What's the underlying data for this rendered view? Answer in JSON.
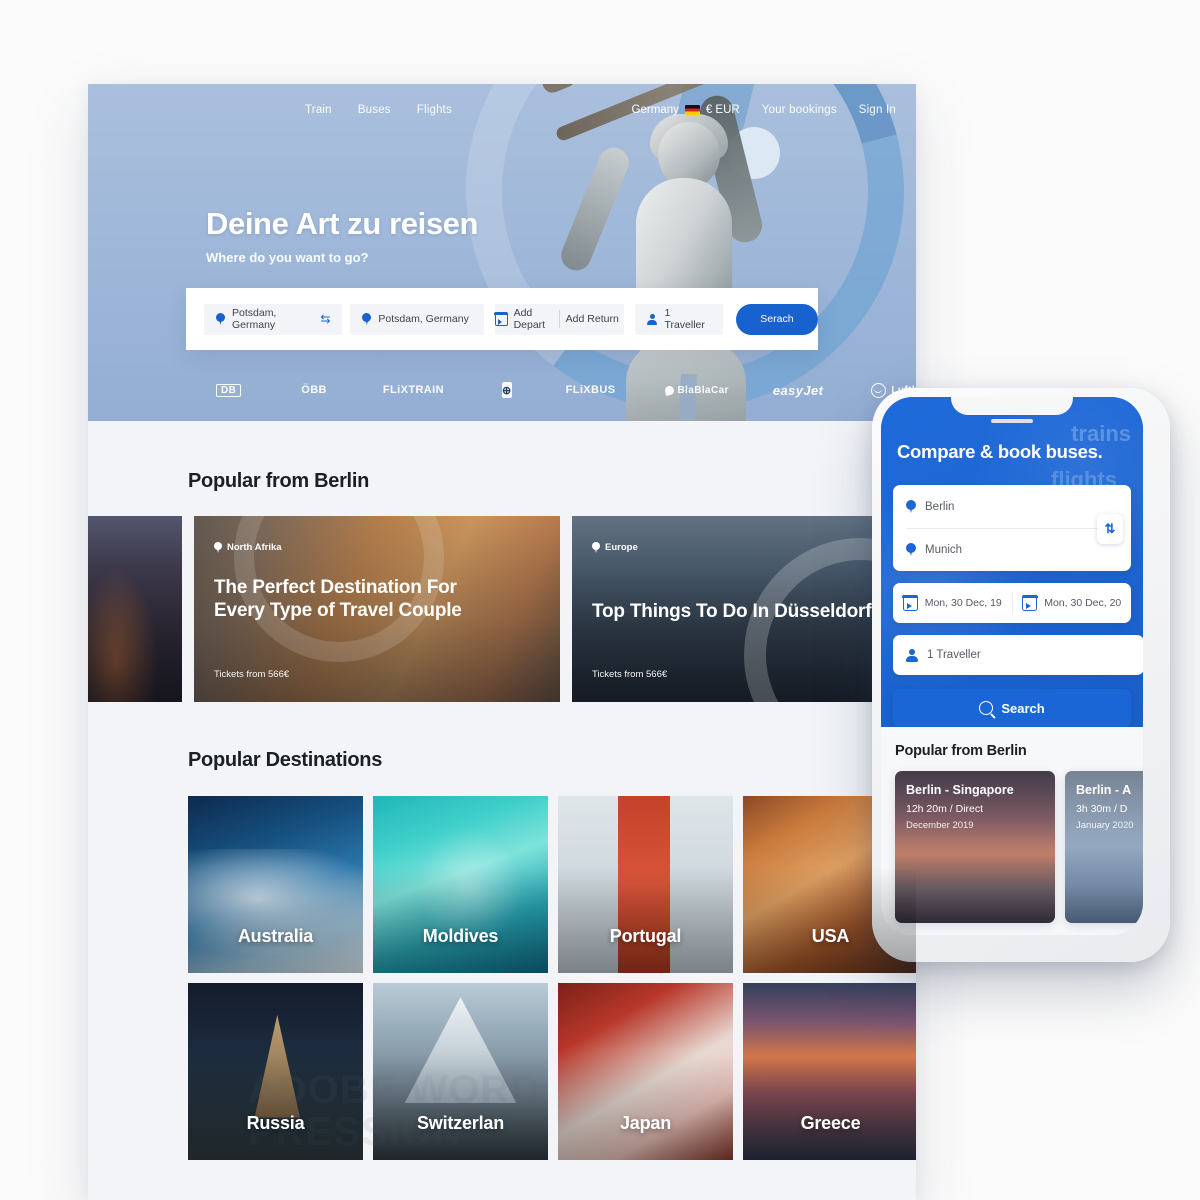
{
  "desktop": {
    "nav": {
      "left_links": [
        "Train",
        "Buses",
        "Flights"
      ],
      "country": "Germany",
      "currency": "€ EUR",
      "bookings": "Your bookings",
      "signin": "Sign In"
    },
    "hero": {
      "title": "Deine Art zu reisen",
      "subtitle": "Where do you want to go?"
    },
    "search": {
      "origin": "Potsdam, Germany",
      "destination": "Potsdam, Germany",
      "depart": "Add Depart",
      "return": "Add Return",
      "travellers": "1 Traveller",
      "button": "Serach",
      "swap_icon": "⇆"
    },
    "partners": [
      "DB",
      "ÖBB",
      "FLiXTRAIN",
      "SBB",
      "FLiXBUS",
      "BlaBlaCar",
      "easyJet",
      "Lufthansa"
    ],
    "popular_from": {
      "title": "Popular from Berlin",
      "cards": [
        {
          "tag": "",
          "heading": "",
          "price": ""
        },
        {
          "tag": "North Afrika",
          "heading": "The Perfect Destination For Every Type of Travel Couple",
          "price": "Tickets from 566€"
        },
        {
          "tag": "Europe",
          "heading": "Top Things To Do In Düsseldorf",
          "price": "Tickets from 566€"
        }
      ]
    },
    "destinations": {
      "title": "Popular Destinations",
      "row1": [
        "Australia",
        "Moldives",
        "Portugal",
        "USA"
      ],
      "row2": [
        "Russia",
        "Switzerlan",
        "Japan",
        "Greece"
      ]
    },
    "watermark": "ADOBE WORD PRESSION"
  },
  "phone": {
    "ghost_top": "trains",
    "ghost_bottom": "flights",
    "title": "Compare & book buses.",
    "origin": "Berlin",
    "destination": "Munich",
    "depart": "Mon, 30 Dec, 19",
    "return": "Mon, 30 Dec, 20",
    "travellers": "1 Traveller",
    "search": "Search",
    "swap_icon": "⇅",
    "section_title": "Popular from Berlin",
    "trips": [
      {
        "route": "Berlin - Singapore",
        "duration": "12h 20m / Direct",
        "date": "December 2019"
      },
      {
        "route": "Berlin - A",
        "duration": "3h 30m / D",
        "date": "January 2020"
      }
    ]
  },
  "colors": {
    "accent_blue": "#1862cf",
    "phone_blue": "#1b66d6",
    "page_bg": "#f2f4f8"
  }
}
